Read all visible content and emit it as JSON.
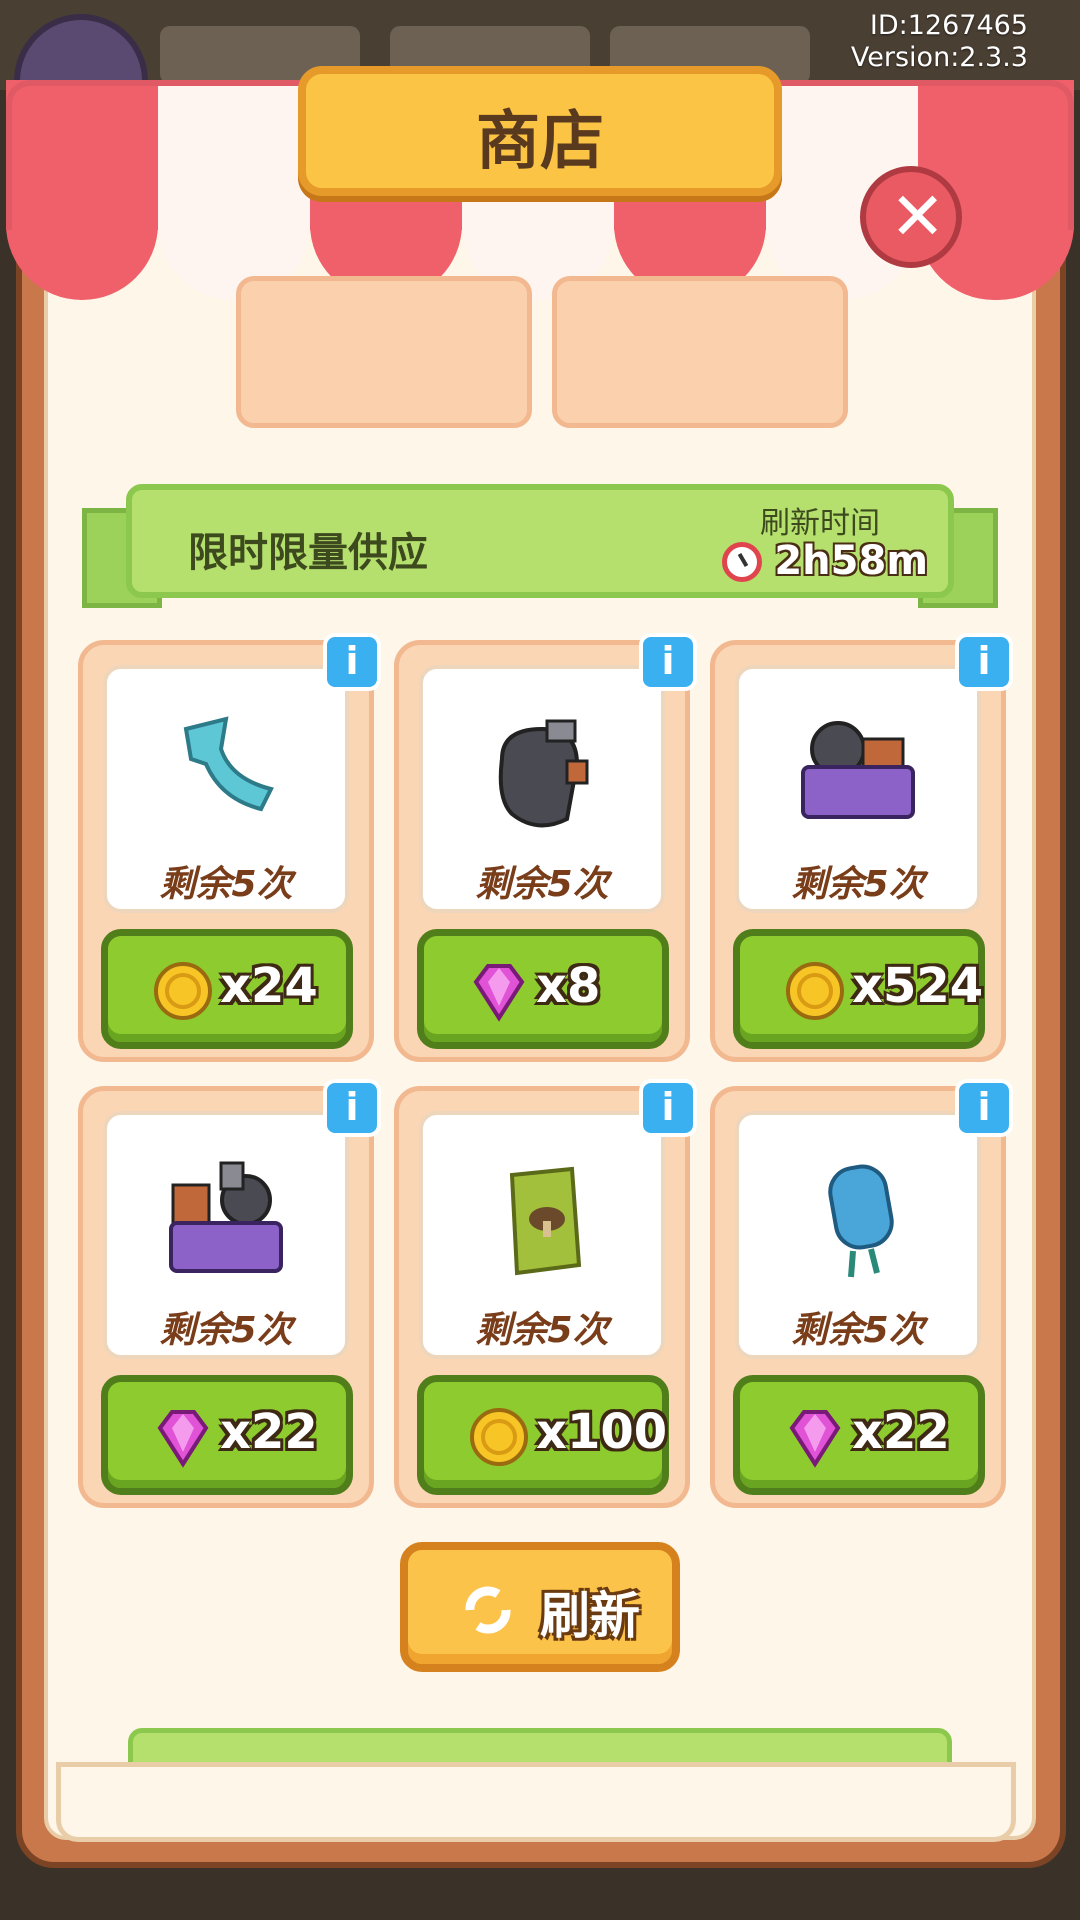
{
  "meta": {
    "id_text": "ID:1267465",
    "version_text": "Version:2.3.3"
  },
  "shop": {
    "title": "商店",
    "section_title": "限时限量供应",
    "refresh_label": "刷新时间",
    "refresh_time": "2h58m",
    "refresh_button_label": "刷新",
    "info_symbol": "i",
    "close_symbol": "✕",
    "items": [
      {
        "item_icon": "teal-scarf-icon",
        "remain": "剩余5次",
        "currency_icon": "gold-coin-icon",
        "price": "x24"
      },
      {
        "item_icon": "boxing-glove-icon",
        "remain": "剩余5次",
        "currency_icon": "purple-gem-icon",
        "price": "x8"
      },
      {
        "item_icon": "equipment-basket-icon",
        "remain": "剩余5次",
        "currency_icon": "gold-coin-icon",
        "price": "x524"
      },
      {
        "item_icon": "gear-basket-icon",
        "remain": "剩余5次",
        "currency_icon": "purple-gem-icon",
        "price": "x22"
      },
      {
        "item_icon": "mushroom-seed-bag-icon",
        "remain": "剩余5次",
        "currency_icon": "gold-coin-icon",
        "price": "x100"
      },
      {
        "item_icon": "blue-capacitor-icon",
        "remain": "剩余5次",
        "currency_icon": "purple-gem-icon",
        "price": "x22"
      }
    ]
  },
  "colors": {
    "awning_red": "#f0606a",
    "panel_brown": "#c8784a",
    "title_yellow": "#fcc444",
    "ribbon_green": "#b5e06e",
    "button_green": "#8ecb2e",
    "info_blue": "#3bb0f0"
  }
}
